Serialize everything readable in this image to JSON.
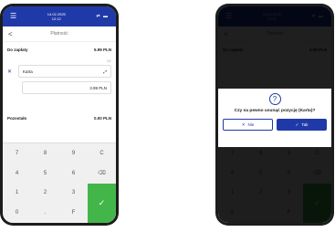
{
  "status": {
    "date": "14.02.2025",
    "time": "12:12",
    "icons": "⇄ ▬"
  },
  "header": {
    "back": "<",
    "title": "Płatność"
  },
  "payment": {
    "due_label": "Do zapłaty",
    "due_value": "5.99 PLN",
    "count": "0/2",
    "method": "Karta",
    "method_amount": "3.99 PLN",
    "remaining_label": "Pozostało",
    "remaining_value": "0.00 PLN"
  },
  "keypad": {
    "k7": "7",
    "k8": "8",
    "k9": "9",
    "kC": "C",
    "k4": "4",
    "k5": "5",
    "k6": "6",
    "k1": "1",
    "k2": "2",
    "k3": "3",
    "k0": "0",
    "kdot": ".",
    "kF": "F"
  },
  "dialog": {
    "question_icon": "?",
    "message": "Czy na pewno usunąć pozycję (Karta)?",
    "no_label": "Nie",
    "yes_label": "Tak"
  },
  "colors": {
    "brand": "#1f3aa8",
    "confirm": "#43b649"
  }
}
